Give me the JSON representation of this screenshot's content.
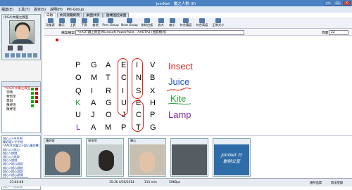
{
  "window": {
    "title": "JoinNet - 繼之人數 (6)"
  },
  "menu": [
    "檔案(E)",
    "工具(T)",
    "說定(S)",
    "說明(H)",
    "PO-Group"
  ],
  "left_panel": {
    "user_name": "(PGA)文繼之教室",
    "user_tree": [
      {
        "label": "*AAOT文繼之教室",
        "color": "red"
      },
      {
        "label": "宇晴",
        "color": "black"
      },
      {
        "label": "林怡萍",
        "color": "black"
      },
      {
        "label": "慧琪",
        "color": "black"
      },
      {
        "label": "陳妤瑄",
        "color": "black"
      },
      {
        "label": "陳妤瑄",
        "color": "black"
      }
    ],
    "chat": [
      "說心=>平平吧",
      "陳妤瑄>平平吧",
      "*AAOT文繼之>說心事的專訂",
      "說心=>說心",
      "說心>說說",
      "說心=>說說",
      "說心>說說",
      "說心>說心說說",
      "說心>說心說說",
      "說心>說心說說",
      "說心>說心說得",
      "說心=>說大說說的",
      "說心=>說心的說說",
      "說心=>說說說"
    ]
  },
  "tabs": [
    "白板",
    "共同瀏覽網頁",
    "桌面共享",
    "遠端遙控桌面"
  ],
  "toolbar": [
    "功能表",
    "顯示",
    "上頁",
    "下頁",
    "檢視",
    "Prev Group",
    "Next Group",
    "刪除白板",
    "放大",
    "縮小",
    "符合寬度",
    "符合高度",
    "正常大小"
  ],
  "file_bar": {
    "label": "檔案檔案:",
    "file": "*AAOT讀上教室\\Microsoft PowerPoint - AAOTA3 [相容模式]",
    "page_label": "頁面:",
    "page": "22"
  },
  "puzzle": {
    "rows": [
      [
        "P",
        "G",
        "A",
        "E",
        "I",
        "V"
      ],
      [
        "O",
        "M",
        "T",
        "C",
        "N",
        "B"
      ],
      [
        "Q",
        "I",
        "R",
        "I",
        "S",
        "X"
      ],
      [
        "K",
        "A",
        "G",
        "U",
        "E",
        "H"
      ],
      [
        "U",
        "J",
        "O",
        "J",
        "C",
        "P"
      ],
      [
        "L",
        "A",
        "M",
        "P",
        "T",
        "G"
      ]
    ],
    "words": [
      "Insect",
      "Juice",
      "Kite",
      "Lamp"
    ],
    "colors": {
      "insect": "#e0201a",
      "juice": "#1f55c4",
      "kite": "#2a9a3a",
      "lamp": "#7a2a9a"
    }
  },
  "thumbs": [
    "陳妤瑄",
    "林怡萍",
    "陳心",
    "",
    "JoinNet 行動辦公室"
  ],
  "status": {
    "time": "21:40:46",
    "meeting_time": "15:36 4/30/2014",
    "duration": "115 min",
    "bitrate": "59KBps",
    "right1": "維持品質",
    "right2": "無法登錄"
  }
}
